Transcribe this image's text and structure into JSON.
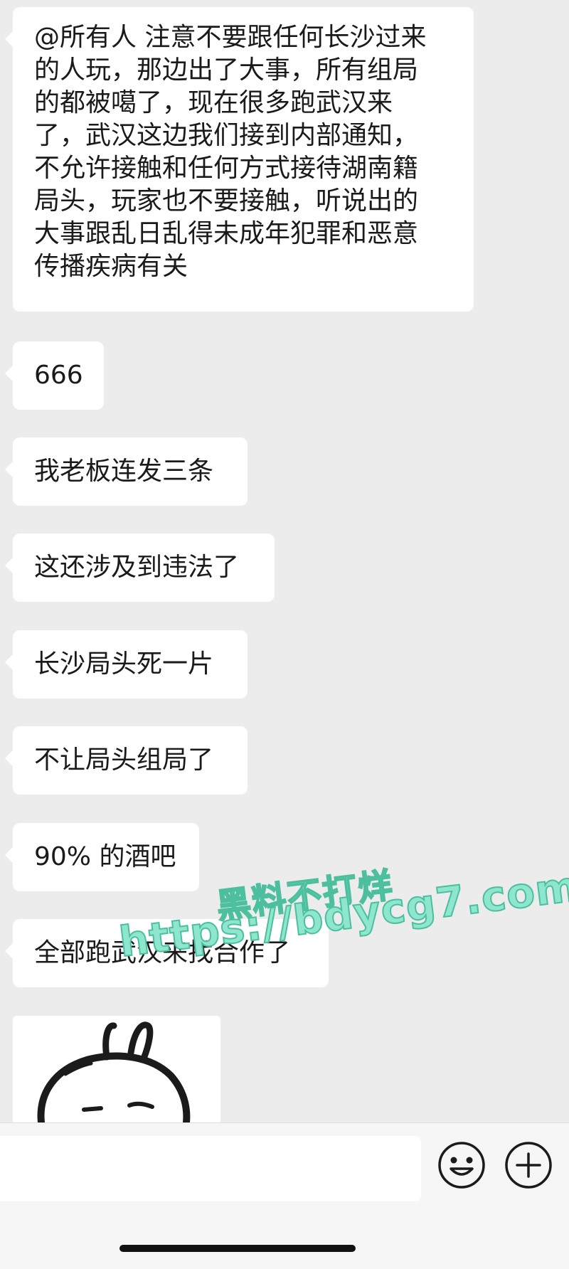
{
  "messages": [
    {
      "text": "@所有人 注意不要跟任何长沙过来\n的人玩，那边出了大事，所有组局\n的都被噶了，现在很多跑武汉来\n了，武汉这边我们接到内部通知，\n不允许接触和任何方式接待湖南籍\n局头，玩家也不要接触，听说出的\n大事跟乱日乱得未成年犯罪和恶意\n传播疾病有关"
    },
    {
      "text": "666"
    },
    {
      "text": "我老板连发三条"
    },
    {
      "text": "这还涉及到违法了"
    },
    {
      "text": "长沙局头死一片"
    },
    {
      "text": "不让局头组局了"
    },
    {
      "text": "90% 的酒吧"
    },
    {
      "text": "全部跑武汉来找合作了"
    }
  ],
  "sticker": {
    "icon": "bunny-face-sticker"
  },
  "watermark": {
    "line1": "黑料不打烊",
    "line2": "https://bdycg7.com"
  },
  "input_bar": {
    "input_value": "",
    "emoji_icon": "smiley-icon",
    "plus_icon": "plus-circle-icon"
  },
  "colors": {
    "background": "#ececec",
    "bubble": "#ffffff",
    "watermark": "#8ee6cf"
  }
}
